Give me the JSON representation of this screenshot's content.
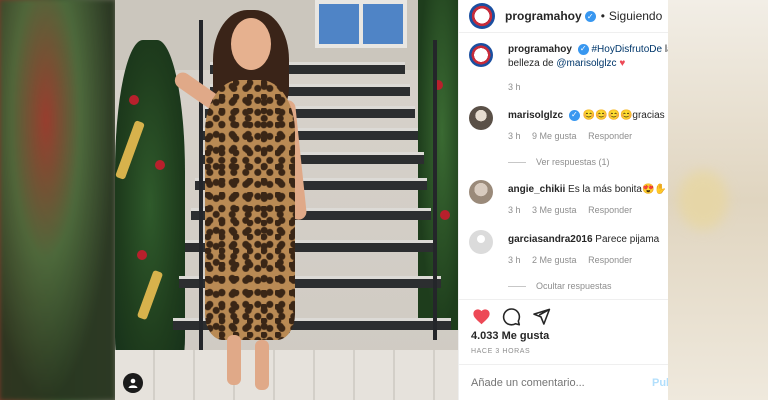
{
  "header": {
    "username": "programahoy",
    "verified_mark": "✓",
    "separator": "•",
    "follow_status": "Siguiendo"
  },
  "caption": {
    "username": "programahoy",
    "verified_mark": "✓",
    "hashtag": "#HoyDisfrutoDe",
    "text_after_hashtag": " la belleza de ",
    "mention": "@marisolglzc",
    "emoji": "♥",
    "time": "3 h"
  },
  "comments": [
    {
      "username": "marisolglzc",
      "verified_mark": "✓",
      "text": "😊😊😊😊gracias",
      "time": "3 h",
      "likes": "9 Me gusta",
      "reply_label": "Responder",
      "replies_toggle": "Ver respuestas (1)",
      "avatar_icon": "avatar-icon"
    },
    {
      "username": "angie_chikii",
      "text": "Es la más bonita😍✋",
      "time": "3 h",
      "likes": "3 Me gusta",
      "reply_label": "Responder",
      "avatar_icon": "avatar-icon"
    },
    {
      "username": "garciasandra2016",
      "text": "Parece pijama",
      "time": "3 h",
      "likes": "2 Me gusta",
      "reply_label": "Responder",
      "replies_toggle": "Ocultar respuestas",
      "avatar_icon": "default-avatar-icon"
    }
  ],
  "actions": {
    "like_icon": "heart-icon",
    "comment_icon": "comment-icon",
    "share_icon": "paper-plane-icon",
    "like_color": "#ed4956",
    "likes_count": "4.033 Me gusta",
    "time_ago": "HACE 3 HORAS"
  },
  "add_comment": {
    "placeholder": "Añade un comentario...",
    "post_label": "Publicar"
  },
  "photo": {
    "user_tag_icon": "person-icon"
  },
  "colors": {
    "link": "#00376b",
    "verified": "#3897f0",
    "muted": "#8e8e8e",
    "post_button_disabled": "#b2dffc"
  }
}
